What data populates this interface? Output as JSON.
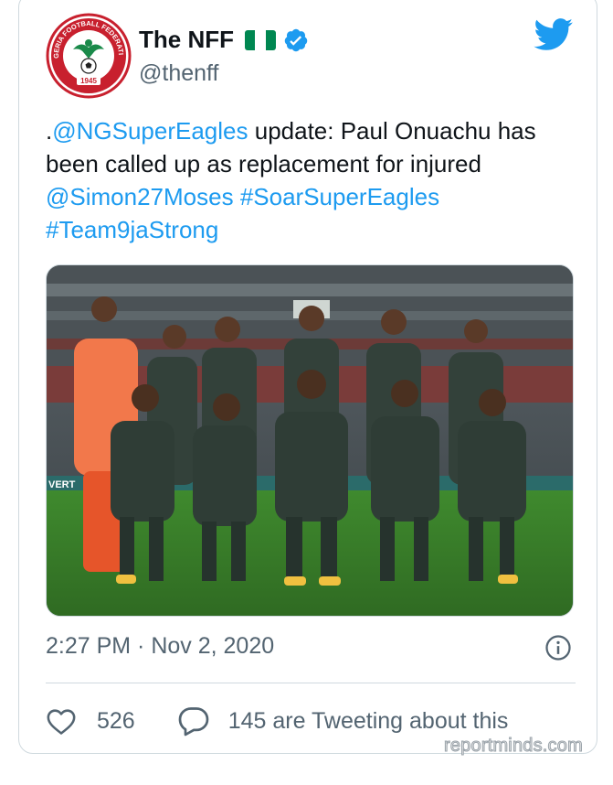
{
  "author": {
    "display_name": "The NFF",
    "handle": "@thenff",
    "avatar_text": {
      "top": "NIGERIA FOOTBALL FEDERATION",
      "year": "1945"
    },
    "flag_colors": [
      "#008751",
      "#ffffff",
      "#008751"
    ]
  },
  "tweet": {
    "segments": [
      {
        "text": ".",
        "type": "text"
      },
      {
        "text": "@NGSuperEagles",
        "type": "link"
      },
      {
        "text": " update: Paul Onuachu has been called up as replacement for injured ",
        "type": "text"
      },
      {
        "text": "@Simon27Moses",
        "type": "link"
      },
      {
        "text": " ",
        "type": "text"
      },
      {
        "text": "#SoarSuperEagles",
        "type": "link"
      },
      {
        "text": " ",
        "type": "text"
      },
      {
        "text": "#Team9jaStrong",
        "type": "link"
      }
    ]
  },
  "media": {
    "banner_text": "VERT"
  },
  "timestamp": "2:27 PM · Nov 2, 2020",
  "actions": {
    "likes": "526",
    "retweet_text": "145 are Tweeting about this"
  },
  "watermark": "reportminds.com",
  "colors": {
    "link": "#1d9bf0",
    "muted": "#536471",
    "border": "#cfd9de",
    "jersey": "#33413a",
    "keeper": "#f2784b"
  },
  "icons": [
    "twitter-bird-icon",
    "verified-badge-icon",
    "info-icon",
    "heart-icon",
    "reply-bubble-icon"
  ]
}
